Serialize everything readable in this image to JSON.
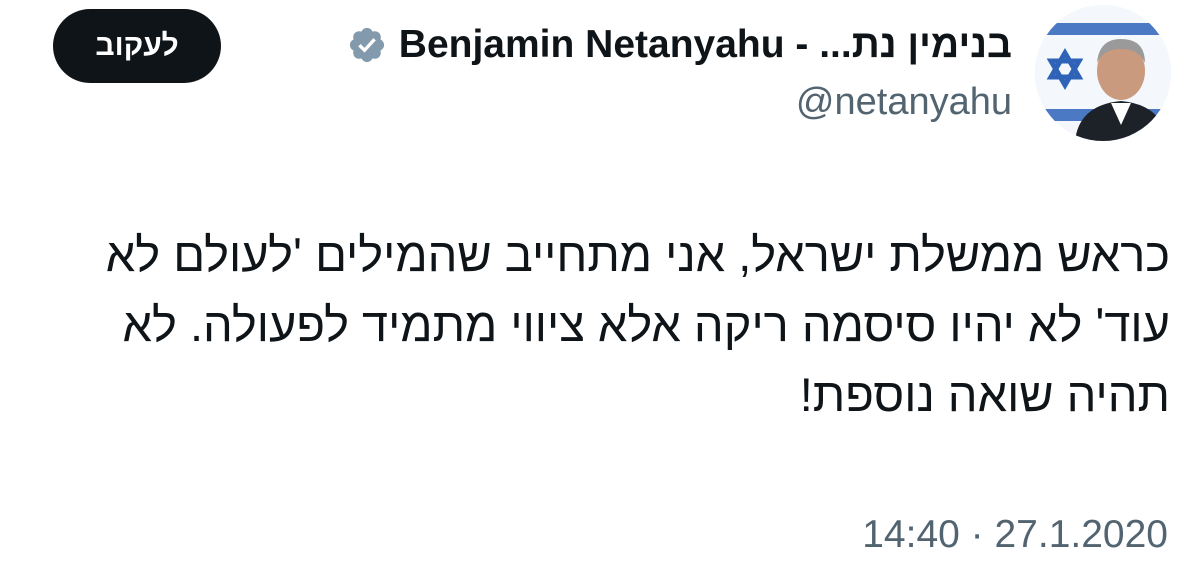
{
  "author": {
    "display_name": "בנימין נת... - Benjamin Netanyahu",
    "handle": "@netanyahu",
    "verified_icon": "verified-badge-icon",
    "verified_color": "#829aab"
  },
  "follow_button": {
    "label": "לעקוב"
  },
  "tweet": {
    "lines": [
      "כראש ממשלת ישראל, אני מתחייב שהמילים 'לעולם לא",
      "עוד' לא יהיו סיסמה ריקה אלא ציווי מתמיד לפעולה. לא",
      "תהיה שואה נוספת!"
    ]
  },
  "timestamp": {
    "text": "14:40 · 27.1.2020"
  },
  "colors": {
    "text_primary": "#0f1419",
    "text_secondary": "#536471",
    "button_bg": "#0f1419",
    "button_text": "#ffffff"
  }
}
